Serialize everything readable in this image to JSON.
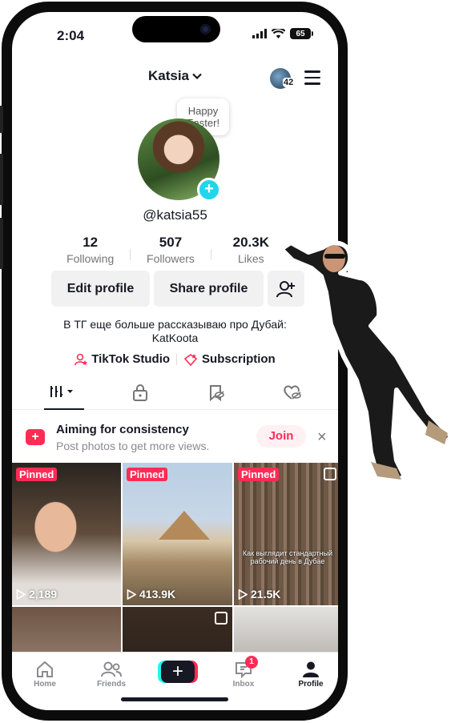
{
  "status": {
    "time": "2:04",
    "battery": "65"
  },
  "header": {
    "username": "Katsia",
    "notif_count": "42"
  },
  "profile": {
    "bubble_line1": "Happy",
    "bubble_line2": "Easter!",
    "handle": "@katsia55",
    "stats": [
      {
        "value": "12",
        "label": "Following"
      },
      {
        "value": "507",
        "label": "Followers"
      },
      {
        "value": "20.3K",
        "label": "Likes"
      }
    ],
    "edit_profile": "Edit profile",
    "share_profile": "Share profile",
    "bio_line1": "В ТГ еще больше рассказываю про Дубай:",
    "bio_line2": "KatKoota",
    "studio_link": "TikTok Studio",
    "subscription_link": "Subscription"
  },
  "banner": {
    "title": "Aiming for consistency",
    "subtitle": "Post photos to get more views.",
    "join": "Join",
    "close": "×"
  },
  "videos": [
    {
      "pinned": "Pinned",
      "views": "2,189"
    },
    {
      "pinned": "Pinned",
      "views": "413.9K"
    },
    {
      "pinned": "Pinned",
      "views": "21.5K",
      "overlay": "Как выглядит стандартный рабочий день в Дубае"
    }
  ],
  "nav": {
    "home": "Home",
    "friends": "Friends",
    "inbox": "Inbox",
    "inbox_badge": "1",
    "profile": "Profile"
  },
  "colors": {
    "accent": "#fe2c55",
    "cyan": "#25f4ee",
    "plus": "#20d5ec"
  }
}
